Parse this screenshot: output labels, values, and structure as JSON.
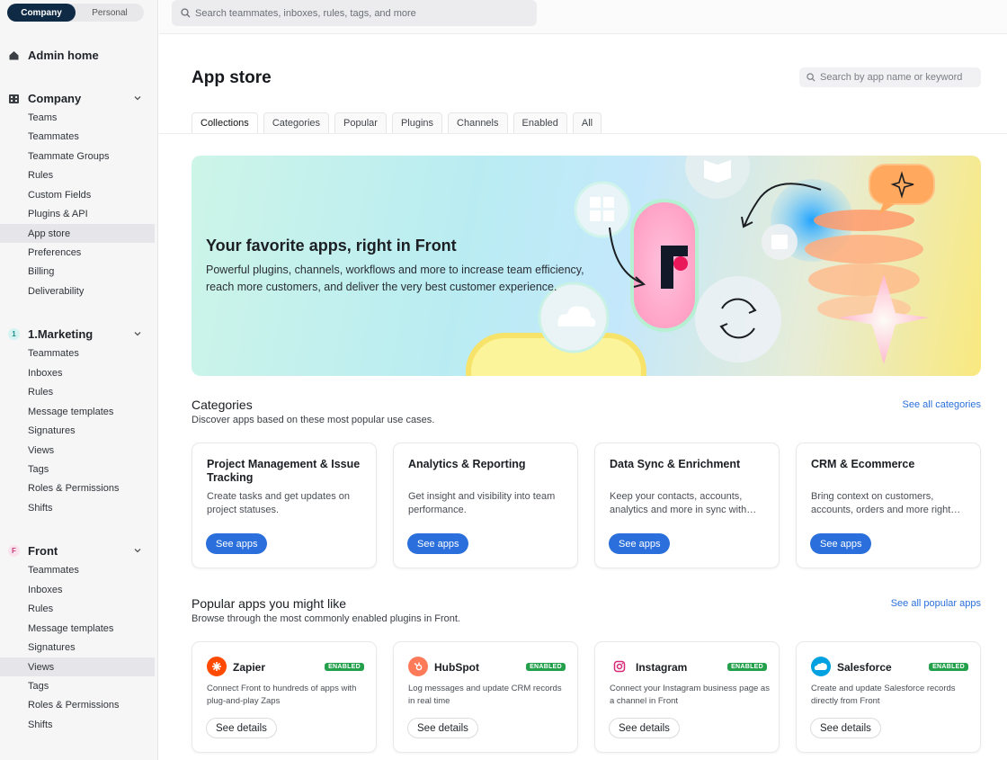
{
  "switcher": {
    "company": "Company",
    "personal": "Personal"
  },
  "search": {
    "placeholder": "Search teammates, inboxes, rules, tags, and more"
  },
  "sidebar": {
    "admin_home": "Admin home",
    "company": {
      "label": "Company",
      "items": [
        "Teams",
        "Teammates",
        "Teammate Groups",
        "Rules",
        "Custom Fields",
        "Plugins & API",
        "App store",
        "Preferences",
        "Billing",
        "Deliverability"
      ]
    },
    "marketing": {
      "badge": "1",
      "label": "1.Marketing",
      "items": [
        "Teammates",
        "Inboxes",
        "Rules",
        "Message templates",
        "Signatures",
        "Views",
        "Tags",
        "Roles & Permissions",
        "Shifts"
      ]
    },
    "front": {
      "badge": "F",
      "label": "Front",
      "items": [
        "Teammates",
        "Inboxes",
        "Rules",
        "Message templates",
        "Signatures",
        "Views",
        "Tags",
        "Roles & Permissions",
        "Shifts"
      ]
    }
  },
  "page": {
    "title": "App store",
    "search_placeholder": "Search by app name or keyword",
    "tabs": [
      "Collections",
      "Categories",
      "Popular",
      "Plugins",
      "Channels",
      "Enabled",
      "All"
    ]
  },
  "hero": {
    "title": "Your favorite apps, right in Front",
    "desc": "Powerful plugins, channels, workflows and more to increase team efficiency, reach more customers, and deliver the very best customer experience."
  },
  "categories": {
    "title": "Categories",
    "subtitle": "Discover apps based on these most popular use cases.",
    "link": "See all categories",
    "cards": [
      {
        "title": "Project Management & Issue Tracking",
        "desc": "Create tasks and get updates on project statuses.",
        "button": "See apps"
      },
      {
        "title": "Analytics & Reporting",
        "desc": "Get insight and visibility into team performance.",
        "button": "See apps"
      },
      {
        "title": "Data Sync & Enrichment",
        "desc": "Keep your contacts, accounts, analytics and more in sync with…",
        "button": "See apps"
      },
      {
        "title": "CRM & Ecommerce",
        "desc": "Bring context on customers, accounts, orders and more right…",
        "button": "See apps"
      }
    ]
  },
  "popular": {
    "title": "Popular apps you might like",
    "subtitle": "Browse through the most commonly enabled plugins in Front.",
    "link": "See all popular apps",
    "apps": [
      {
        "name": "Zapier",
        "badge": "ENABLED",
        "desc": "Connect Front to hundreds of apps with plug-and-play Zaps",
        "button": "See details",
        "color": "#ff4a00"
      },
      {
        "name": "HubSpot",
        "badge": "ENABLED",
        "desc": "Log messages and update CRM records in real time",
        "button": "See details",
        "color": "#ff7a59"
      },
      {
        "name": "Instagram",
        "badge": "ENABLED",
        "desc": "Connect your Instagram business page as a channel in Front",
        "button": "See details",
        "color": "#d62976"
      },
      {
        "name": "Salesforce",
        "badge": "ENABLED",
        "desc": "Create and update Salesforce records directly from Front",
        "button": "See details",
        "color": "#00a1e0"
      }
    ]
  }
}
